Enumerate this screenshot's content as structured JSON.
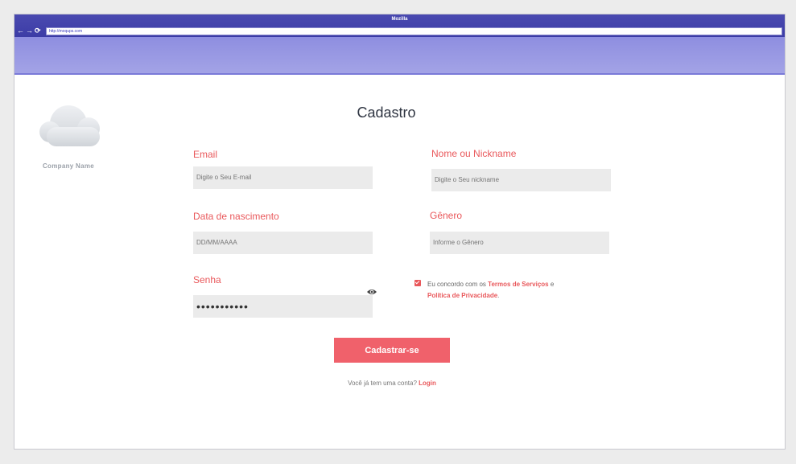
{
  "browser": {
    "title": "Mozilla",
    "url": "http://moqups.com",
    "nav_icons": [
      "back-arrow-icon",
      "forward-arrow-icon",
      "reload-icon"
    ]
  },
  "sidebar": {
    "logo_icon": "cloud-icon",
    "company_name": "Company Name"
  },
  "form": {
    "heading": "Cadastro",
    "email": {
      "label": "Email",
      "placeholder": "Digite o Seu E-mail"
    },
    "nickname": {
      "label": "Nome ou Nickname",
      "placeholder": "Digite o Seu nickname"
    },
    "birthdate": {
      "label": "Data de nascimento",
      "placeholder": "DD/MM/AAAA"
    },
    "gender": {
      "label": "Gênero",
      "placeholder": "Informe o Gênero"
    },
    "password": {
      "label": "Senha",
      "value": "•••••••••••",
      "toggle_icon": "eye-icon"
    },
    "terms": {
      "checked": true,
      "prefix": "Eu concordo com os",
      "terms_link": "Termos de Serviços",
      "connector": "e",
      "privacy_link": "Política de Privacidade",
      "suffix": "."
    },
    "submit_label": "Cadastrar-se",
    "login_prompt": "Você já tem uma conta?",
    "login_link": "Login"
  },
  "colors": {
    "accent": "#e9585b",
    "button": "#f0616b",
    "titlebar": "#3c3ca6",
    "header_band": "#9b9be4"
  }
}
